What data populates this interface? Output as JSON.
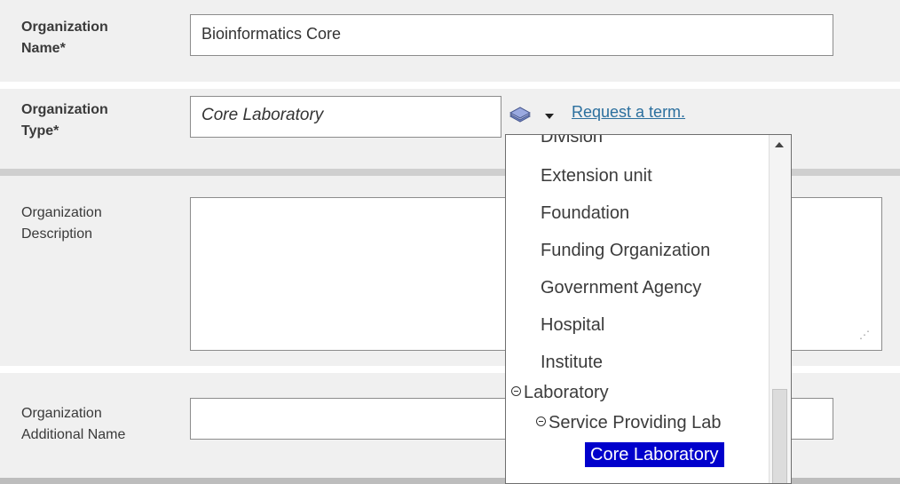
{
  "form": {
    "name": {
      "label_line1": "Organization",
      "label_line2": "Name*",
      "value": "Bioinformatics Core"
    },
    "type": {
      "label_line1": "Organization",
      "label_line2": "Type*",
      "value": "Core Laboratory",
      "request_link": "Request a term."
    },
    "description": {
      "label_line1": "Organization",
      "label_line2": "Description",
      "value": ""
    },
    "additional_name": {
      "label_line1": "Organization",
      "label_line2": "Additional Name",
      "value": ""
    }
  },
  "dropdown": {
    "items": [
      {
        "label": "Division",
        "indent": 0,
        "toggle": false
      },
      {
        "label": "Extension unit",
        "indent": 0,
        "toggle": false
      },
      {
        "label": "Foundation",
        "indent": 0,
        "toggle": false
      },
      {
        "label": "Funding Organization",
        "indent": 0,
        "toggle": false
      },
      {
        "label": "Government Agency",
        "indent": 0,
        "toggle": false
      },
      {
        "label": "Hospital",
        "indent": 0,
        "toggle": false
      },
      {
        "label": "Institute",
        "indent": 0,
        "toggle": false
      },
      {
        "label": "Laboratory",
        "indent": 0,
        "toggle": true
      },
      {
        "label": "Service Providing Lab",
        "indent": 1,
        "toggle": true
      },
      {
        "label": "Core Laboratory",
        "indent": 2,
        "toggle": false,
        "selected": true
      }
    ]
  },
  "icons": {
    "picker": "book-stack-icon",
    "caret": "caret-down-icon",
    "toggle": "collapse-circle-icon"
  }
}
